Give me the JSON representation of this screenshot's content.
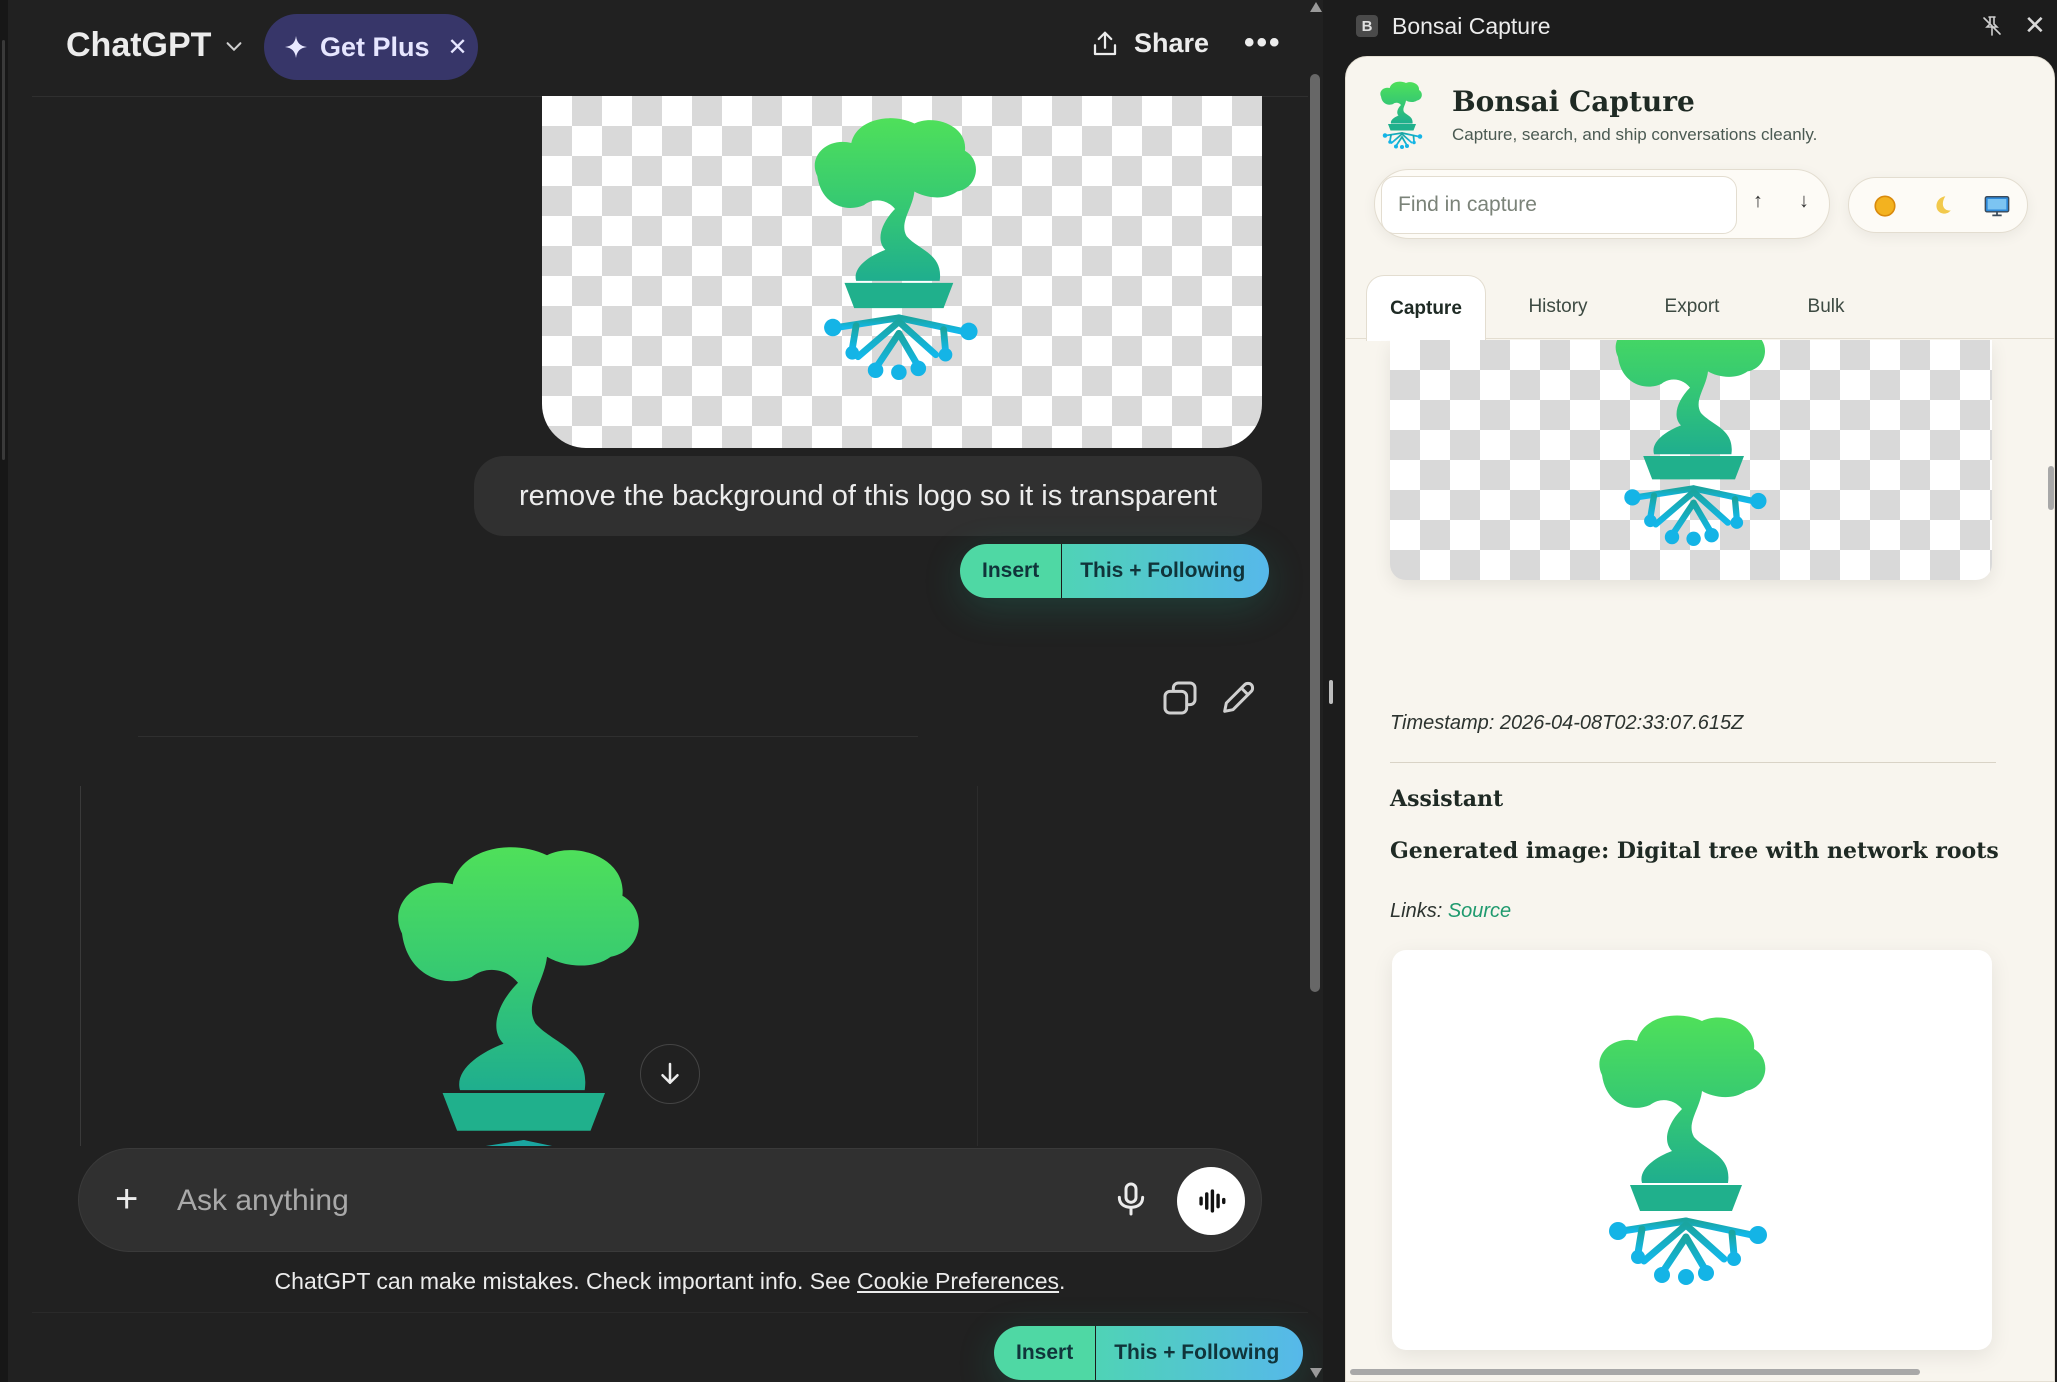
{
  "chat": {
    "brand": "ChatGPT",
    "get_plus_label": "Get Plus",
    "share_label": "Share",
    "user_message": "remove the background of this logo so it is transparent",
    "composer_placeholder": "Ask anything",
    "disclaimer_text": "ChatGPT can make mistakes. Check important info. See ",
    "disclaimer_link": "Cookie Preferences",
    "disclaimer_end": "."
  },
  "insert_pill": {
    "insert_label": "Insert",
    "following_label": "This + Following"
  },
  "panel": {
    "window_title": "Bonsai Capture",
    "window_badge": "B",
    "title": "Bonsai Capture",
    "subtitle": "Capture, search, and ship conversations cleanly.",
    "search_placeholder": "Find in capture",
    "prev_arrow": "↑",
    "next_arrow": "↓",
    "tabs": [
      {
        "label": "Capture",
        "active": true
      },
      {
        "label": "History",
        "active": false
      },
      {
        "label": "Export",
        "active": false
      },
      {
        "label": "Bulk",
        "active": false
      }
    ],
    "capture": {
      "timestamp": "Timestamp: 2026-04-08T02:33:07.615Z",
      "role": "Assistant",
      "generated_title": "Generated image: Digital tree with network roots",
      "links_label": "Links: ",
      "links_source": "Source"
    },
    "theme_icons": [
      "sun-icon",
      "moon-icon",
      "monitor-icon"
    ]
  },
  "colors": {
    "chat_bg": "#212121",
    "plus_pill": "#373669",
    "insert_green": "#4fd8a4",
    "following_blue": "#56b8ea",
    "panel_bg": "#f8f5ee",
    "link_green": "#1f9a6e",
    "logo_green": "#4cd964",
    "logo_teal": "#1fb58a",
    "logo_blue": "#14b4e6"
  }
}
